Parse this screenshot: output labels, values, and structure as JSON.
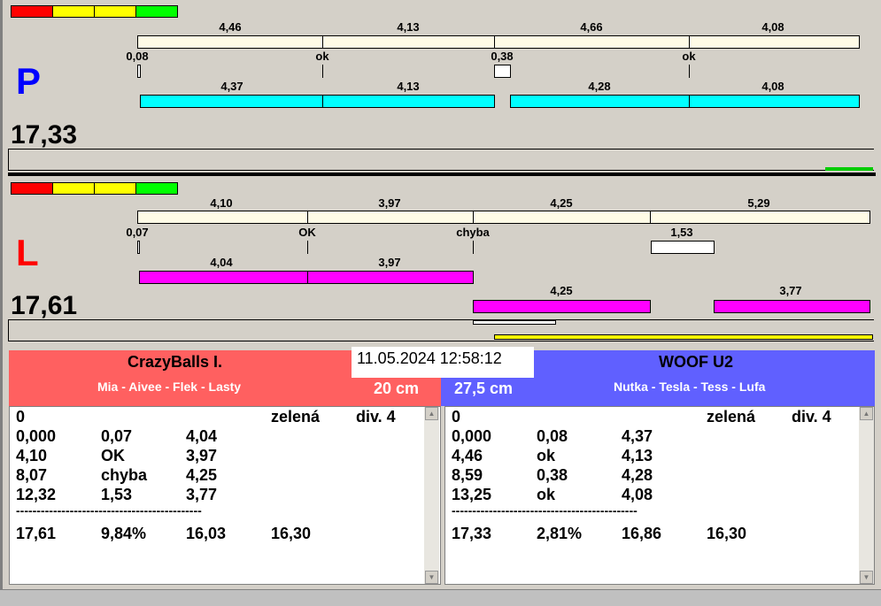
{
  "colors": {
    "red": "#ff0000",
    "yellow": "#ffff00",
    "green": "#00ff00",
    "cream": "#fffbe6",
    "cyan": "#00ffff",
    "magenta": "#ff00ff",
    "team_left": "#ff6060",
    "team_right": "#6060ff"
  },
  "p": {
    "letter": "P",
    "total": "17,33",
    "top_labels": [
      "4,46",
      "4,13",
      "4,66",
      "4,08"
    ],
    "mid_labels": [
      "0,08",
      "ok",
      "0,38",
      "ok"
    ],
    "bottom_labels": [
      "4,37",
      "4,13",
      "4,28",
      "4,08"
    ]
  },
  "l": {
    "letter": "L",
    "total": "17,61",
    "top_labels": [
      "4,10",
      "3,97",
      "4,25",
      "5,29"
    ],
    "mid_labels": [
      "0,07",
      "OK",
      "chyba",
      "1,53"
    ],
    "bottom_labels": [
      "4,04",
      "3,97"
    ],
    "bottom2_labels": [
      "4,25",
      "3,77"
    ]
  },
  "datetime": "11.05.2024 12:58:12",
  "left_team": {
    "name": "CrazyBalls I.",
    "dogs": "Mia - Aivee - Flek - Lasty",
    "height": "20 cm",
    "rows": [
      [
        "0",
        "",
        "",
        "zelená",
        "div. 4"
      ],
      [
        "0,000",
        "0,07",
        "4,04"
      ],
      [
        "4,10",
        "OK",
        "3,97"
      ],
      [
        "8,07",
        "chyba",
        "4,25"
      ],
      [
        "12,32",
        "1,53",
        "3,77"
      ]
    ],
    "separator": "---------------------------------------------",
    "summary": [
      "17,61",
      "9,84%",
      "16,03",
      "16,30"
    ]
  },
  "right_team": {
    "name": "WOOF U2",
    "dogs": "Nutka - Tesla - Tess - Lufa",
    "height": "27,5 cm",
    "rows": [
      [
        "0",
        "",
        "",
        "zelená",
        "div. 4"
      ],
      [
        "0,000",
        "0,08",
        "4,37"
      ],
      [
        "4,46",
        "ok",
        "4,13"
      ],
      [
        "8,59",
        "0,38",
        "4,28"
      ],
      [
        "13,25",
        "ok",
        "4,08"
      ]
    ],
    "separator": "---------------------------------------------",
    "summary": [
      "17,33",
      "2,81%",
      "16,86",
      "16,30"
    ]
  }
}
